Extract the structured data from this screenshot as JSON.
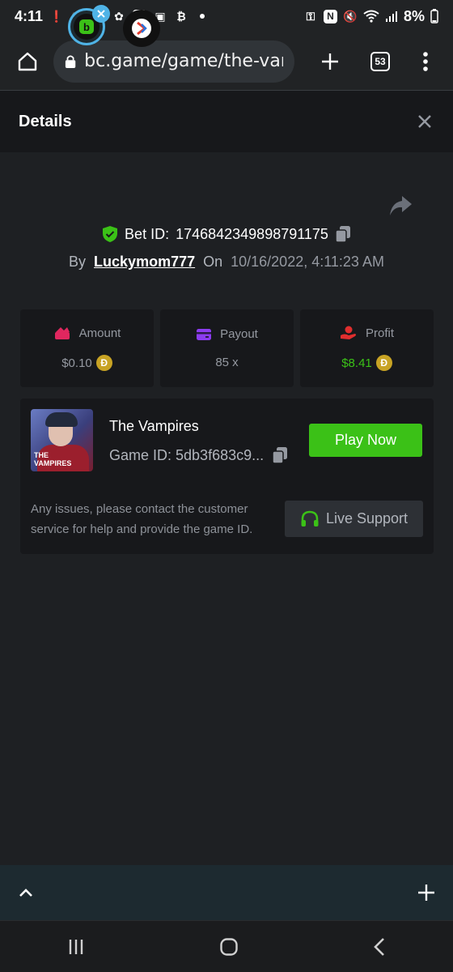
{
  "status_bar": {
    "time": "4:11",
    "battery": "8%"
  },
  "browser": {
    "url": "bc.game/game/the-vamp",
    "tab_count": "53"
  },
  "details": {
    "title": "Details"
  },
  "bet": {
    "bet_id_label": "Bet ID:",
    "bet_id": "1746842349898791175",
    "by_label": "By",
    "user": "Luckymom777",
    "on_label": "On",
    "date": "10/16/2022, 4:11:23 AM"
  },
  "stats": [
    {
      "label": "Amount",
      "value": "$0.10",
      "coin": "Đ"
    },
    {
      "label": "Payout",
      "value": "85 x"
    },
    {
      "label": "Profit",
      "value": "$8.41",
      "coin": "Đ"
    }
  ],
  "game": {
    "name": "The Vampires",
    "thumb_title_1": "THE",
    "thumb_title_2": "VAMPIRES",
    "game_id": "Game ID: 5db3f683c9...",
    "play_label": "Play Now",
    "issue_text": "Any issues, please contact the customer service for help and provide the game ID.",
    "support_label": "Live Support"
  },
  "colors": {
    "accent_green": "#3bc117",
    "coin_gold": "#c8a324",
    "tab_blue": "#4fb3e6"
  }
}
